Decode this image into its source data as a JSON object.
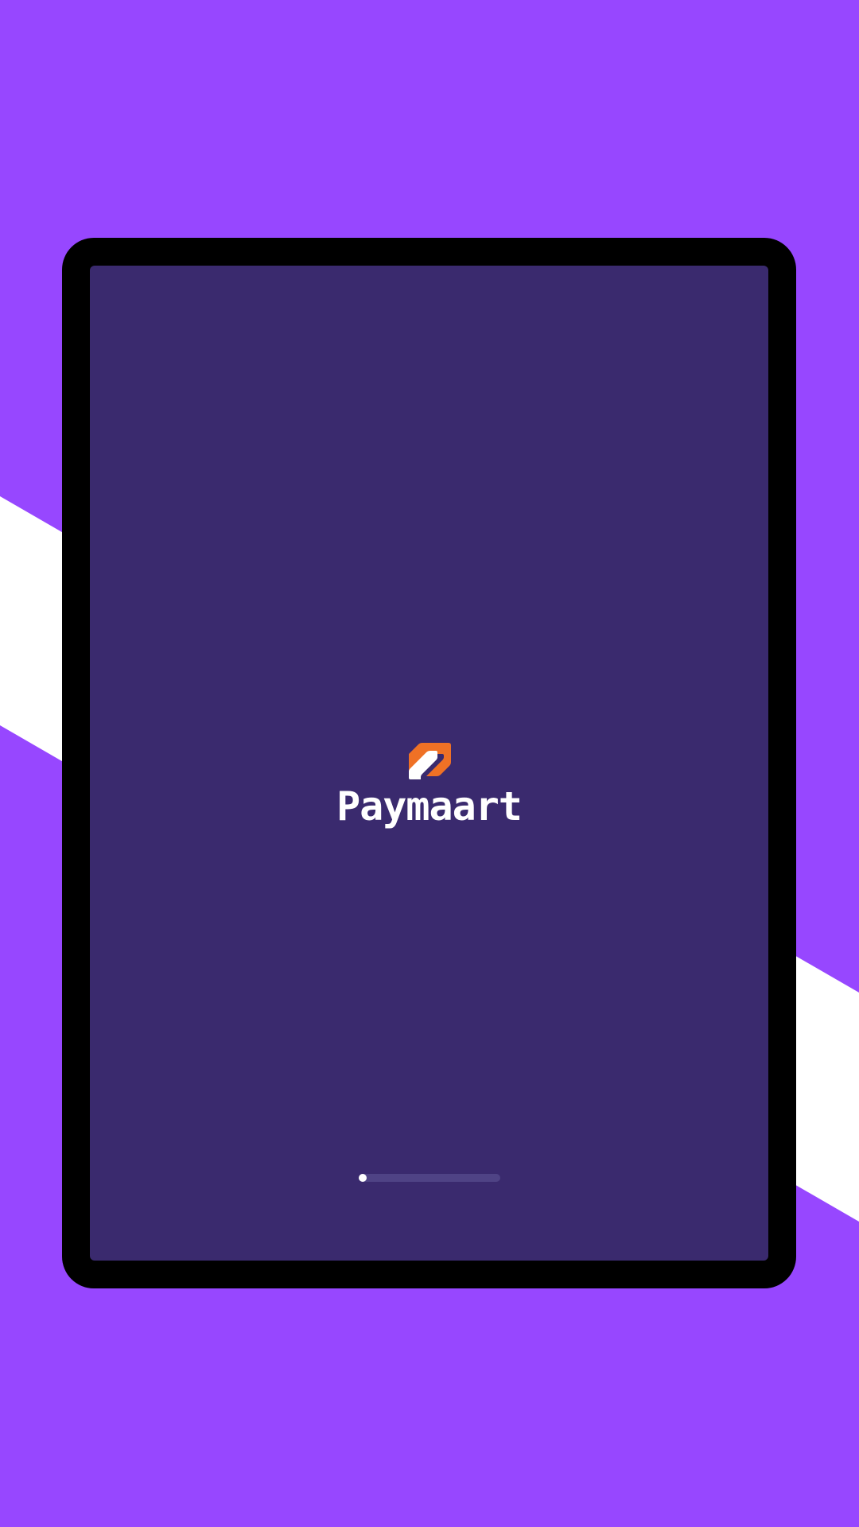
{
  "app": {
    "brand_name": "Paymaart"
  },
  "loading": {
    "progress": 0.04
  },
  "colors": {
    "background": "#9747FF",
    "stripe": "#FFFFFF",
    "device_frame": "#000000",
    "screen": "#3A2A6E",
    "brand_orange": "#EF7125",
    "brand_white": "#FFFFFF",
    "progress_track": "#4F4385",
    "progress_fill": "#FFFFFF"
  },
  "icons": {
    "brand_logo": "paymaart-logo-icon"
  }
}
